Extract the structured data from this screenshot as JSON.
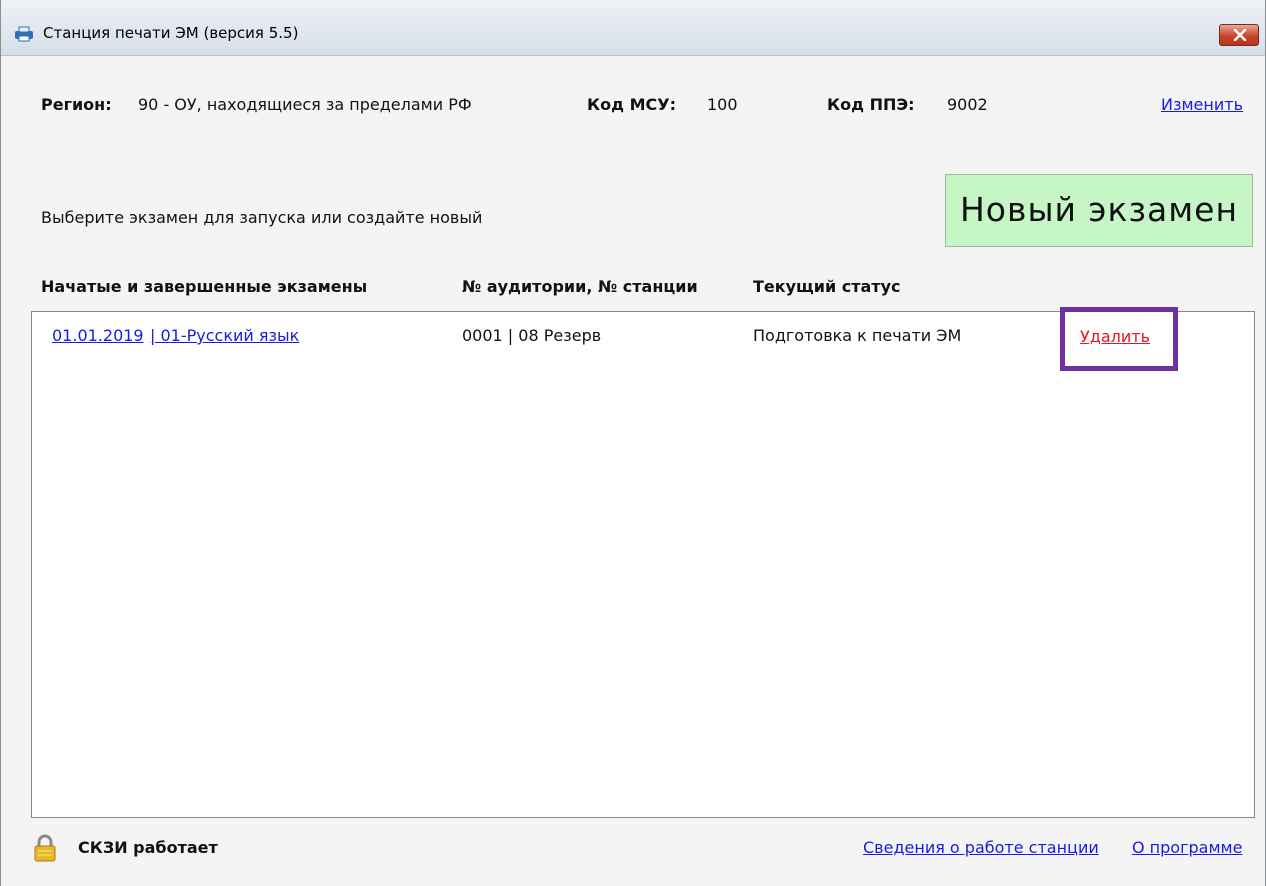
{
  "window": {
    "title": "Станция печати ЭМ (версия 5.5)"
  },
  "header": {
    "region_label": "Регион:",
    "region_value": "90 - ОУ, находящиеся за пределами РФ",
    "msu_label": "Код МСУ:",
    "msu_value": "100",
    "ppe_label": "Код ППЭ:",
    "ppe_value": "9002",
    "change_link": "Изменить"
  },
  "main": {
    "prompt": "Выберите экзамен для запуска или создайте новый",
    "new_exam_button": "Новый экзамен",
    "columns": {
      "exams": "Начатые и завершенные экзамены",
      "room_station": "№ аудитории, № станции",
      "status": "Текущий статус"
    },
    "rows": [
      {
        "date": "01.01.2019",
        "subject": "| 01-Русский язык",
        "room_station": "0001 | 08 Резерв",
        "status": "Подготовка к печати ЭМ",
        "delete": "Удалить"
      }
    ]
  },
  "footer": {
    "skzi_status": "СКЗИ работает",
    "station_info_link": "Сведения о работе станции",
    "about_link": "О программе"
  },
  "colors": {
    "link": "#1a1ae6",
    "delete_link": "#e6141e",
    "new_exam_bg": "#c6f6c6",
    "highlight": "#7030a0"
  }
}
